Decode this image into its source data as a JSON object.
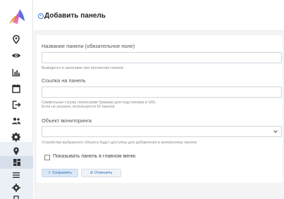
{
  "brand": {
    "logo_icon": "app-logo-icon",
    "accent": "#7b4fc9"
  },
  "sidebar": {
    "items": [
      {
        "name": "sidebar-item-map",
        "icon": "map-pin-outline-icon"
      },
      {
        "name": "sidebar-item-view",
        "icon": "eye-icon"
      },
      {
        "name": "sidebar-item-charts",
        "icon": "bar-chart-icon"
      },
      {
        "name": "sidebar-item-calendar",
        "icon": "calendar-icon"
      },
      {
        "name": "sidebar-item-logout",
        "icon": "logout-icon"
      },
      {
        "name": "sidebar-item-users",
        "icon": "users-icon"
      },
      {
        "name": "sidebar-item-settings",
        "icon": "gear-icon"
      }
    ],
    "subnav": [
      {
        "name": "subnav-item-pin",
        "icon": "map-pin-icon"
      },
      {
        "name": "subnav-item-dashboards",
        "icon": "dashboard-icon",
        "active": true
      },
      {
        "name": "subnav-item-menu",
        "icon": "menu-icon"
      },
      {
        "name": "subnav-item-settings",
        "icon": "gear-small-icon"
      },
      {
        "name": "subnav-item-device",
        "icon": "device-icon"
      }
    ]
  },
  "page": {
    "title": "Добавить панель"
  },
  "form": {
    "name_label": "Название панели (обязательное поле)",
    "name_hint": "Выводится в заголовке при просмотре панели",
    "name_value": "",
    "link_label": "Ссылка на панель",
    "link_hint_1": "Символьная строка латинскими буквами для подстановки в URL.",
    "link_hint_2": "Если не указано, используется ID панели",
    "link_value": "",
    "object_label": "Объект мониторинга",
    "object_value": "",
    "object_hint": "Устройства выбранного объекта будут доступны для добавления в мнемосхему панели",
    "show_in_menu_label": "Показывать панель в главном меню",
    "show_in_menu_checked": false,
    "save_label": "✓ Сохранить",
    "cancel_label": "⊘ Отменить"
  }
}
